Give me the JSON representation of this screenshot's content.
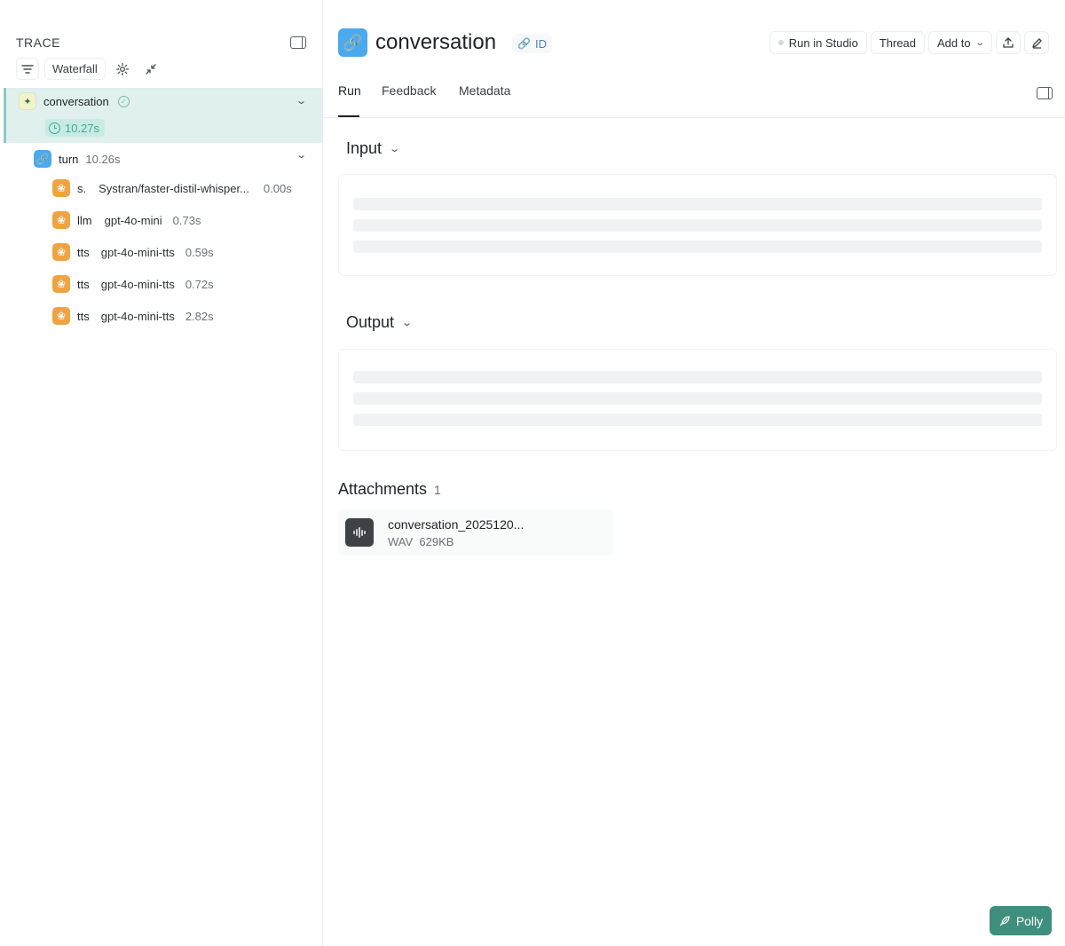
{
  "trace": {
    "title": "TRACE",
    "view_label": "Waterfall",
    "root": {
      "name": "conversation",
      "latency": "10.27s"
    },
    "turn": {
      "name": "turn",
      "latency": "10.26s"
    },
    "children": [
      {
        "type": "s.",
        "model": "Systran/faster-distil-whisper...",
        "latency": "0.00s"
      },
      {
        "type": "llm",
        "model": "gpt-4o-mini",
        "latency": "0.73s"
      },
      {
        "type": "tts",
        "model": "gpt-4o-mini-tts",
        "latency": "0.59s"
      },
      {
        "type": "tts",
        "model": "gpt-4o-mini-tts",
        "latency": "0.72s"
      },
      {
        "type": "tts",
        "model": "gpt-4o-mini-tts",
        "latency": "2.82s"
      }
    ]
  },
  "run": {
    "title": "conversation",
    "id_label": "ID",
    "actions": {
      "studio": "Run in Studio",
      "thread": "Thread",
      "add_to": "Add to"
    },
    "tabs": [
      "Run",
      "Feedback",
      "Metadata"
    ],
    "active_tab": "Run",
    "input_label": "Input",
    "output_label": "Output",
    "attachments": {
      "title": "Attachments",
      "count": "1",
      "file_name": "conversation_2025120...",
      "file_type": "WAV",
      "file_size": "629KB"
    }
  },
  "assistant_label": "Polly",
  "colors": {
    "selected_bg": "#dff0ee",
    "latency_green": "#3fa98f",
    "chain_blue": "#4ba9ee",
    "model_orange": "#f0a342",
    "polly_green": "#3f8f7e"
  }
}
